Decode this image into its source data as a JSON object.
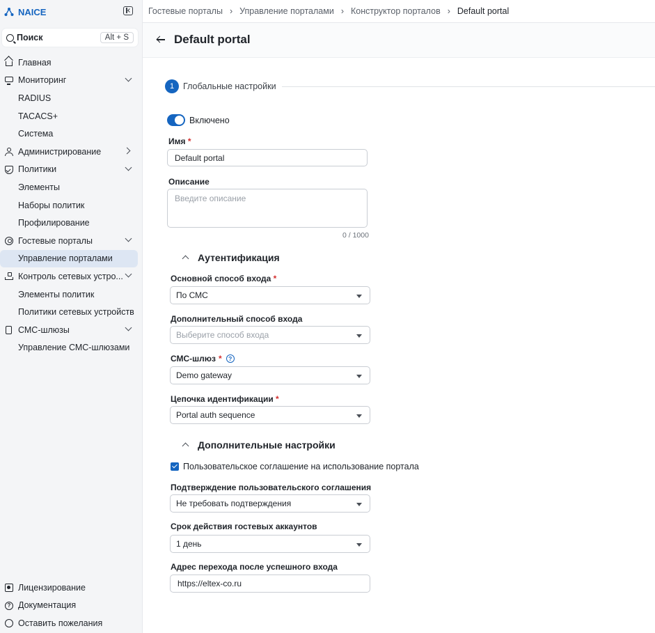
{
  "app": {
    "name": "NAICE",
    "brand_color": "#1565c0"
  },
  "search": {
    "label": "Поиск",
    "shortcut": "Alt + S"
  },
  "sidebar": {
    "items": [
      {
        "label": "Главная",
        "icon": "home-icon"
      },
      {
        "label": "Мониторинг",
        "icon": "monitor-icon"
      },
      {
        "label": "RADIUS"
      },
      {
        "label": "TACACS+"
      },
      {
        "label": "Система"
      },
      {
        "label": "Администрирование",
        "icon": "user-icon"
      },
      {
        "label": "Политики",
        "icon": "shield-icon"
      },
      {
        "label": "Элементы"
      },
      {
        "label": "Наборы политик"
      },
      {
        "label": "Профилирование"
      },
      {
        "label": "Гостевые порталы",
        "icon": "portal-icon"
      },
      {
        "label": "Управление порталами"
      },
      {
        "label": "Контроль сетевых устро...",
        "icon": "network-icon"
      },
      {
        "label": "Элементы политик"
      },
      {
        "label": "Политики сетевых устройств"
      },
      {
        "label": "СМС-шлюзы",
        "icon": "phone-icon"
      },
      {
        "label": "Управление СМС-шлюзами"
      }
    ],
    "bottom": [
      {
        "label": "Лицензирование",
        "icon": "license-icon"
      },
      {
        "label": "Документация",
        "icon": "help-icon"
      },
      {
        "label": "Оставить пожелания",
        "icon": "chat-icon"
      }
    ]
  },
  "breadcrumb": [
    "Гостевые порталы",
    "Управление порталами",
    "Конструктор порталов",
    "Default portal"
  ],
  "page": {
    "title": "Default portal"
  },
  "step": {
    "number": "1",
    "label": "Глобальные настройки"
  },
  "form": {
    "enabled_label": "Включено",
    "enabled": true,
    "name_label": "Имя",
    "name_value": "Default portal",
    "description_label": "Описание",
    "description_placeholder": "Введите описание",
    "description_counter": "0 / 1000",
    "auth_section": "Аутентификация",
    "primary_login_label": "Основной способ входа",
    "primary_login_value": "По СМС",
    "secondary_login_label": "Дополнительный способ входа",
    "secondary_login_placeholder": "Выберите способ входа",
    "sms_gateway_label": "СМС-шлюз",
    "sms_gateway_value": "Demo gateway",
    "id_chain_label": "Цепочка идентификации",
    "id_chain_value": "Portal auth sequence",
    "extra_section": "Дополнительные настройки",
    "agreement_checkbox_label": "Пользовательское соглашение на использование портала",
    "agreement_checked": true,
    "agreement_confirm_label": "Подтверждение пользовательского соглашения",
    "agreement_confirm_value": "Не требовать подтверждения",
    "guest_validity_label": "Срок действия гостевых аккаунтов",
    "guest_validity_value": "1 день",
    "redirect_label": "Адрес перехода после успешного входа",
    "redirect_value": "https://eltex-co.ru",
    "required_mark": "*",
    "help_glyph": "?"
  }
}
